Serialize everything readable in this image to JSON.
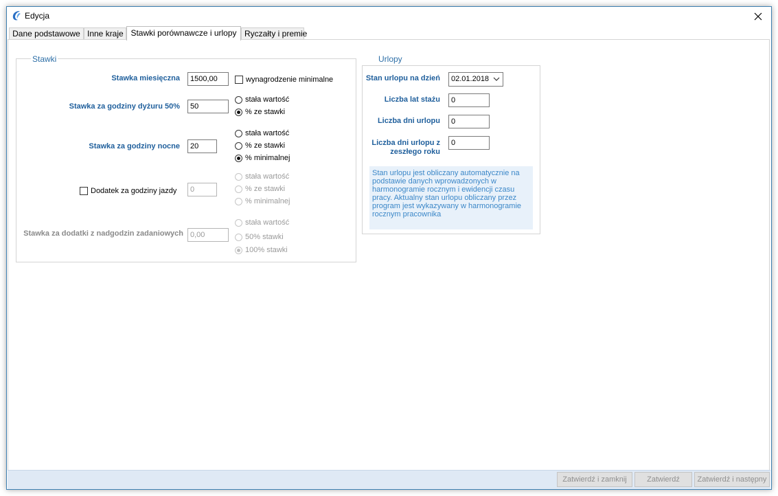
{
  "window": {
    "title": "Edycja",
    "close_glyph": "✕",
    "icon": "app-logo-icon"
  },
  "tabs": [
    {
      "label": "Dane podstawowe"
    },
    {
      "label": "Inne kraje"
    },
    {
      "label": "Stawki porównawcze i urlopy"
    },
    {
      "label": "Ryczałty i premie"
    }
  ],
  "stawki": {
    "group_title": "Stawki",
    "miesieczna": {
      "label": "Stawka miesięczna",
      "value": "1500,00",
      "checkbox_label": "wynagrodzenie minimalne"
    },
    "dyzur": {
      "label": "Stawka za godziny dyżuru 50%",
      "value": "50",
      "opt1": "stała wartość",
      "opt2": "% ze stawki"
    },
    "nocne": {
      "label": "Stawka za godziny nocne",
      "value": "20",
      "opt1": "stała wartość",
      "opt2": "% ze stawki",
      "opt3": "% minimalnej"
    },
    "jazdy": {
      "label": "Dodatek za godziny jazdy",
      "value": "0",
      "opt1": "stała wartość",
      "opt2": "% ze stawki",
      "opt3": "% minimalnej"
    },
    "nadgodziny": {
      "label": "Stawka za dodatki z nadgodzin zadaniowych",
      "value": "0,00",
      "opt1": "stała wartość",
      "opt2": "50% stawki",
      "opt3": "100% stawki"
    }
  },
  "urlopy": {
    "group_title": "Urlopy",
    "stan_label": "Stan urlopu na dzień",
    "stan_value": "02.01.2018",
    "lat_stazu_label": "Liczba lat stażu",
    "lat_stazu_value": "0",
    "dni_label": "Liczba dni urlopu",
    "dni_value": "0",
    "dni_zeszly_label_1": "Liczba dni urlopu z",
    "dni_zeszly_label_2": "zeszłego roku",
    "dni_zeszly_value": "0",
    "info": "Stan urlopu jest obliczany automatycznie na podstawie danych wprowadzonych w harmonogramie rocznym i ewidencji czasu pracy. Aktualny stan urlopu obliczany przez program jest wykazywany w harmonogramie rocznym pracownika"
  },
  "footer": {
    "btn_confirm_close": "Zatwierdź i zamknij",
    "btn_confirm": "Zatwierdź",
    "btn_confirm_next": "Zatwierdź i następny"
  },
  "colors": {
    "accent": "#1f5f9c",
    "info_bg": "#e8f1fa",
    "info_text": "#3b87c8",
    "footer_bg": "#dfe9f5"
  }
}
